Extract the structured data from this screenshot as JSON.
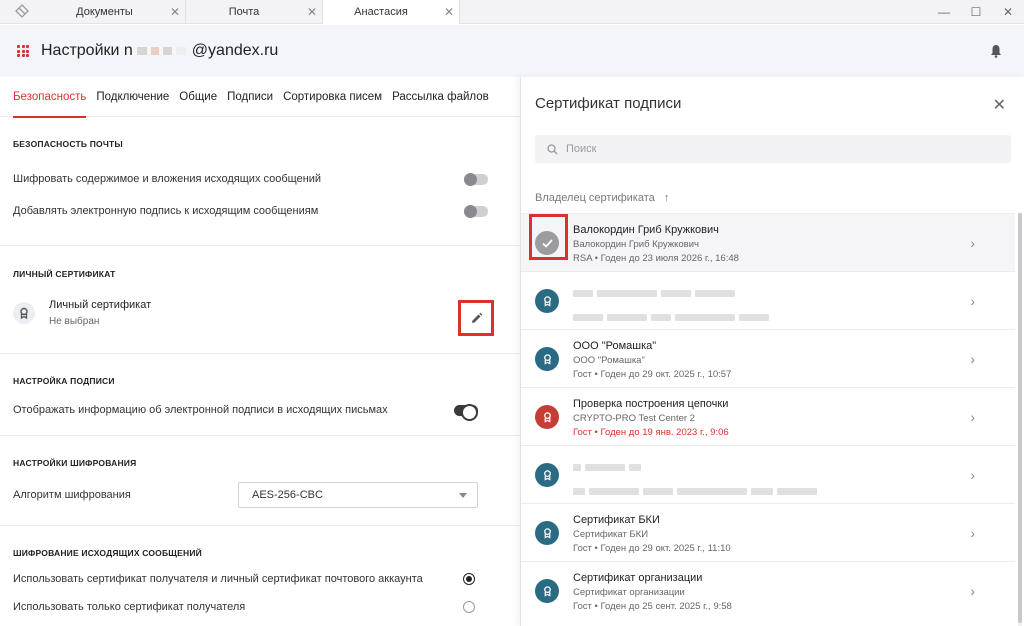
{
  "tabbar": {
    "tabs": [
      {
        "label": "Документы",
        "close": "✕"
      },
      {
        "label": "Почта",
        "close": "✕"
      },
      {
        "label": "Анастасия",
        "close": "✕"
      }
    ],
    "window": {
      "minimize": "—",
      "maximize": "☐",
      "close": "✕"
    }
  },
  "header": {
    "title_prefix": "Настройки n",
    "title_suffix": "@yandex.ru"
  },
  "settings": {
    "tabs": [
      "Безопасность",
      "Подключение",
      "Общие",
      "Подписи",
      "Сортировка писем",
      "Рассылка файлов"
    ],
    "mail_security": {
      "title": "Безопасность почты",
      "encrypt": "Шифровать содержимое и вложения исходящих сообщений",
      "sign": "Добавлять электронную подпись к исходящим сообщениям"
    },
    "personal_cert": {
      "title": "Личный сертификат",
      "name": "Личный сертификат",
      "status": "Не выбран"
    },
    "signature": {
      "title": "Настройка подписи",
      "show_info": "Отображать информацию об электронной подписи в исходящих письмах"
    },
    "encryption": {
      "title": "Настройки шифрования",
      "algo_label": "Алгоритм шифрования",
      "algo_value": "AES-256-CBC"
    },
    "outgoing": {
      "title": "Шифрование исходящих сообщений",
      "opt1": "Использовать сертификат получателя и личный сертификат почтового аккаунта",
      "opt2": "Использовать только сертификат получателя"
    }
  },
  "panel": {
    "title": "Сертификат подписи",
    "close": "✕",
    "search_placeholder": "Поиск",
    "sort_label": "Владелец сертификата",
    "sort_arrow": "↑",
    "items": [
      {
        "name": "Валокордин Гриб Кружкович",
        "owner": "Валокордин Гриб Кружкович",
        "meta": "RSA • Годен до 23 июля 2026 г., 16:48"
      },
      {
        "name": "",
        "owner": "",
        "meta": ""
      },
      {
        "name": "ООО \"Ромашка\"",
        "owner": "ООО \"Ромашка\"",
        "meta": "Гост • Годен до 29 окт. 2025 г., 10:57"
      },
      {
        "name": "Проверка построения цепочки",
        "owner": "CRYPTO-PRO Test Center 2",
        "meta": "Гост • Годен до 19 янв. 2023 г., 9:06"
      },
      {
        "name": "",
        "owner": "",
        "meta": ""
      },
      {
        "name": "Сертификат БКИ",
        "owner": "Сертификат БКИ",
        "meta": "Гост • Годен до 29 окт. 2025 г., 11:10"
      },
      {
        "name": "Сертификат организации",
        "owner": "Сертификат организации",
        "meta": "Гост • Годен до 25 сент. 2025 г., 9:58"
      }
    ]
  },
  "colors": {
    "accent": "#d6332c",
    "teal": "#2a6b83"
  }
}
